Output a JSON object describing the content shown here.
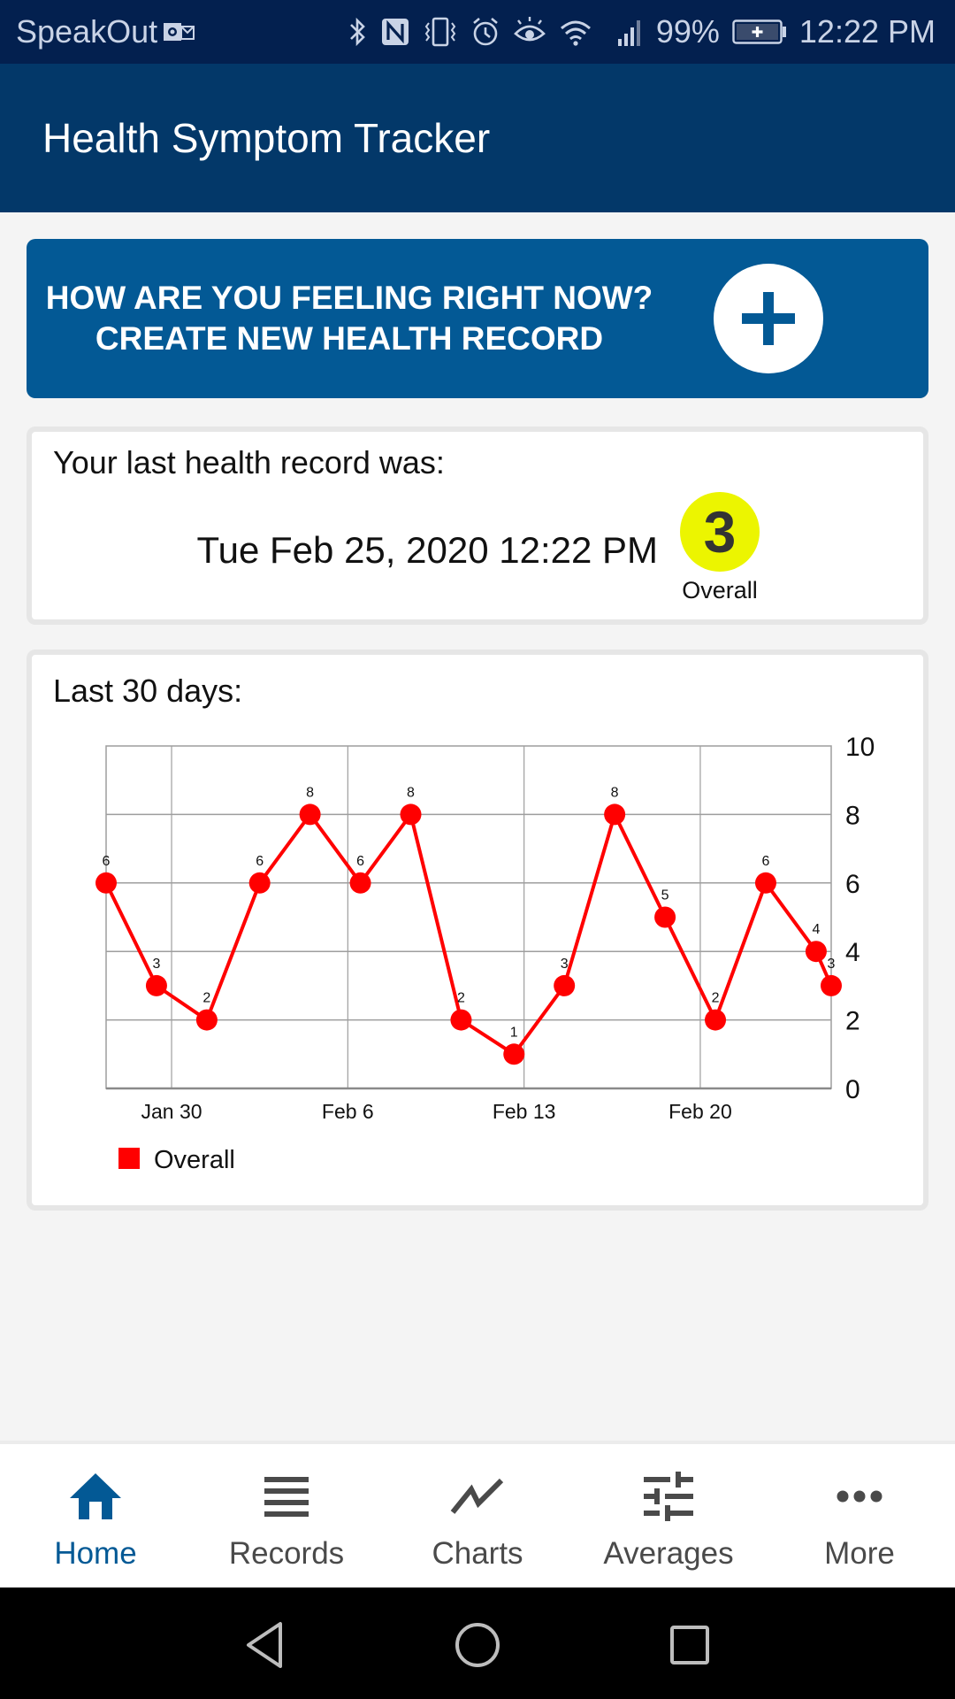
{
  "status_bar": {
    "carrier": "SpeakOut",
    "battery": "99%",
    "time": "12:22 PM",
    "icons": [
      "outlook-icon",
      "bluetooth-icon",
      "nfc-icon",
      "vibrate-icon",
      "alarm-icon",
      "eye-comfort-icon",
      "wifi-icon",
      "signal-icon",
      "battery-charging-icon"
    ]
  },
  "app_bar": {
    "title": "Health Symptom Tracker"
  },
  "create_record": {
    "line1": "HOW ARE YOU FEELING RIGHT NOW?",
    "line2": "CREATE NEW HEALTH RECORD",
    "icon": "plus-icon",
    "color": "#035995"
  },
  "last_record": {
    "heading": "Your last health record was:",
    "datetime": "Tue Feb 25, 2020 12:22 PM",
    "score": "3",
    "score_label": "Overall",
    "score_color": "#ecf500"
  },
  "last_30": {
    "heading": "Last 30 days:"
  },
  "chart_data": {
    "type": "line",
    "title": "",
    "xlabel": "",
    "ylabel": "",
    "x_tick_labels": [
      "Jan 30",
      "Feb 6",
      "Feb 13",
      "Feb 20"
    ],
    "x_tick_day_offsets": [
      0,
      7,
      14,
      21
    ],
    "x_range_day_offsets": [
      -2.6,
      26.2
    ],
    "y_ticks": [
      0,
      2,
      4,
      6,
      8,
      10
    ],
    "ylim": [
      0,
      10
    ],
    "y_axis_side": "right",
    "grid": true,
    "legend": {
      "position": "bottom-left",
      "entries": [
        "Overall"
      ]
    },
    "series": [
      {
        "name": "Overall",
        "color": "#ff0000",
        "x_day_offsets": [
          -2.6,
          -0.6,
          1.4,
          3.5,
          5.5,
          7.5,
          9.5,
          11.5,
          13.6,
          15.6,
          17.6,
          19.6,
          21.6,
          23.6,
          25.6,
          26.2
        ],
        "values": [
          6,
          3,
          2,
          6,
          8,
          6,
          8,
          2,
          1,
          3,
          8,
          5,
          2,
          6,
          4,
          3
        ],
        "data_labels": [
          "6",
          "3",
          "2",
          "6",
          "8",
          "6",
          "8",
          "2",
          "1",
          "3",
          "8",
          "5",
          "2",
          "6",
          "4",
          "3"
        ]
      }
    ]
  },
  "bottom_nav": {
    "items": [
      {
        "label": "Home",
        "icon": "home-icon",
        "active": true
      },
      {
        "label": "Records",
        "icon": "list-icon",
        "active": false
      },
      {
        "label": "Charts",
        "icon": "chart-line-icon",
        "active": false
      },
      {
        "label": "Averages",
        "icon": "sliders-icon",
        "active": false
      },
      {
        "label": "More",
        "icon": "more-icon",
        "active": false
      }
    ],
    "active_color": "#035995",
    "inactive_color": "#4a4a4a"
  },
  "system_nav": {
    "buttons": [
      "back",
      "home",
      "recents"
    ]
  }
}
